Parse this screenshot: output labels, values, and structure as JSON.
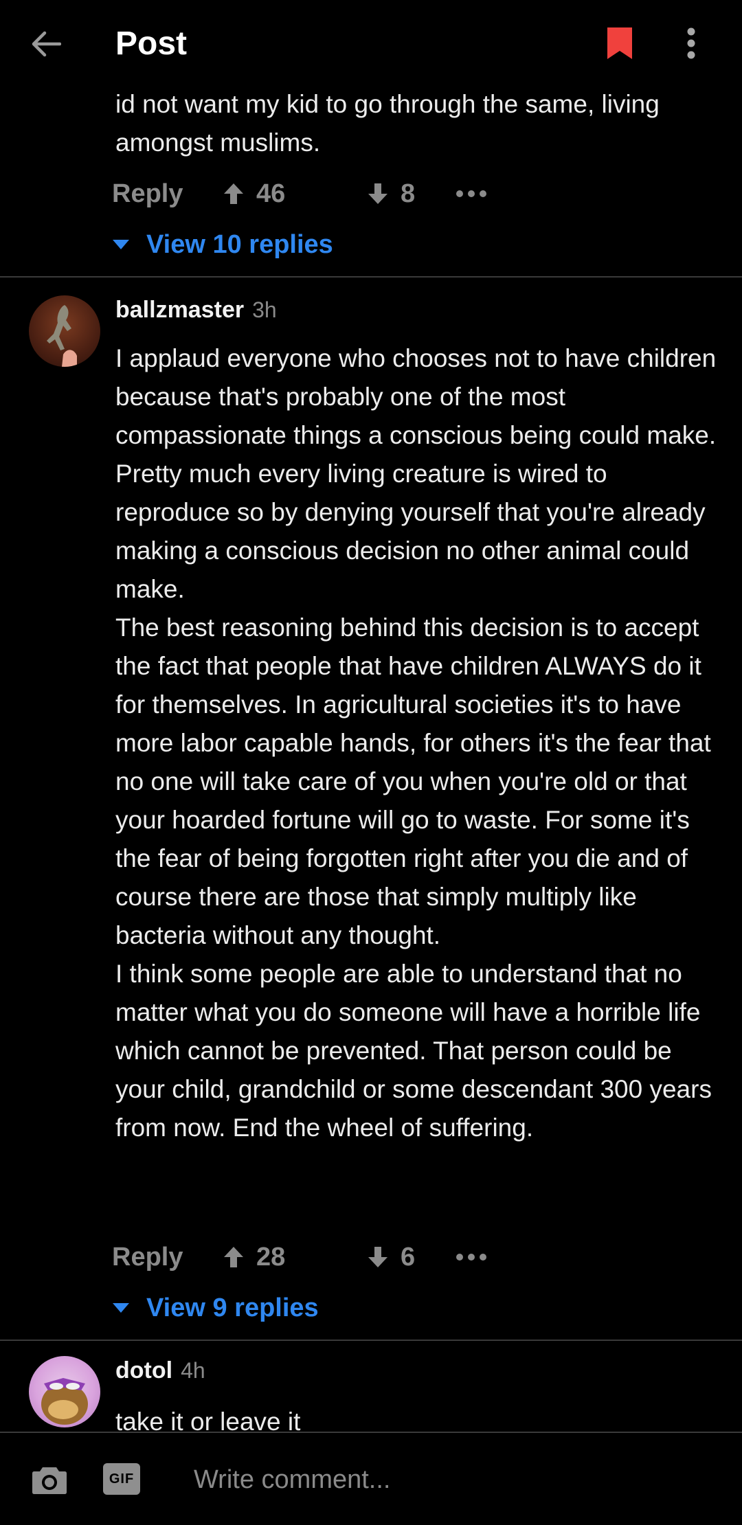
{
  "header": {
    "title": "Post"
  },
  "top_comment": {
    "body": "id not want my kid to go through the same, living amongst muslims.",
    "reply_label": "Reply",
    "upvotes": "46",
    "downvotes": "8",
    "view_replies": "View 10 replies"
  },
  "comments": [
    {
      "username": "ballzmaster",
      "time": "3h",
      "body": "I applaud everyone who chooses not to have children because that's probably one of the most compassionate things a conscious being could make. Pretty much every living creature is wired to reproduce so by denying yourself that you're already making a conscious decision no other animal could make.\nThe best reasoning behind this decision is to accept the fact that people that have children ALWAYS do it for themselves. In agricultural societies it's to have more labor capable hands, for others it's the fear that no one will take care of you when you're old or that your hoarded fortune will go to waste. For some it's the fear of being forgotten right after you die and of course there are those that simply multiply like bacteria without any thought.\nI think some people are able to understand that no matter what you do someone will have a horrible life which cannot be prevented. That person could be your child, grandchild or some descendant 300 years from now. End the wheel of suffering.",
      "reply_label": "Reply",
      "upvotes": "28",
      "downvotes": "6",
      "view_replies": "View 9 replies"
    },
    {
      "username": "dotol",
      "time": "4h",
      "body": "take it or leave it"
    }
  ],
  "composer": {
    "gif_label": "GIF",
    "placeholder": "Write comment..."
  },
  "colors": {
    "accent": "#2f87f0",
    "bookmark": "#f0413d",
    "background": "#000000"
  }
}
